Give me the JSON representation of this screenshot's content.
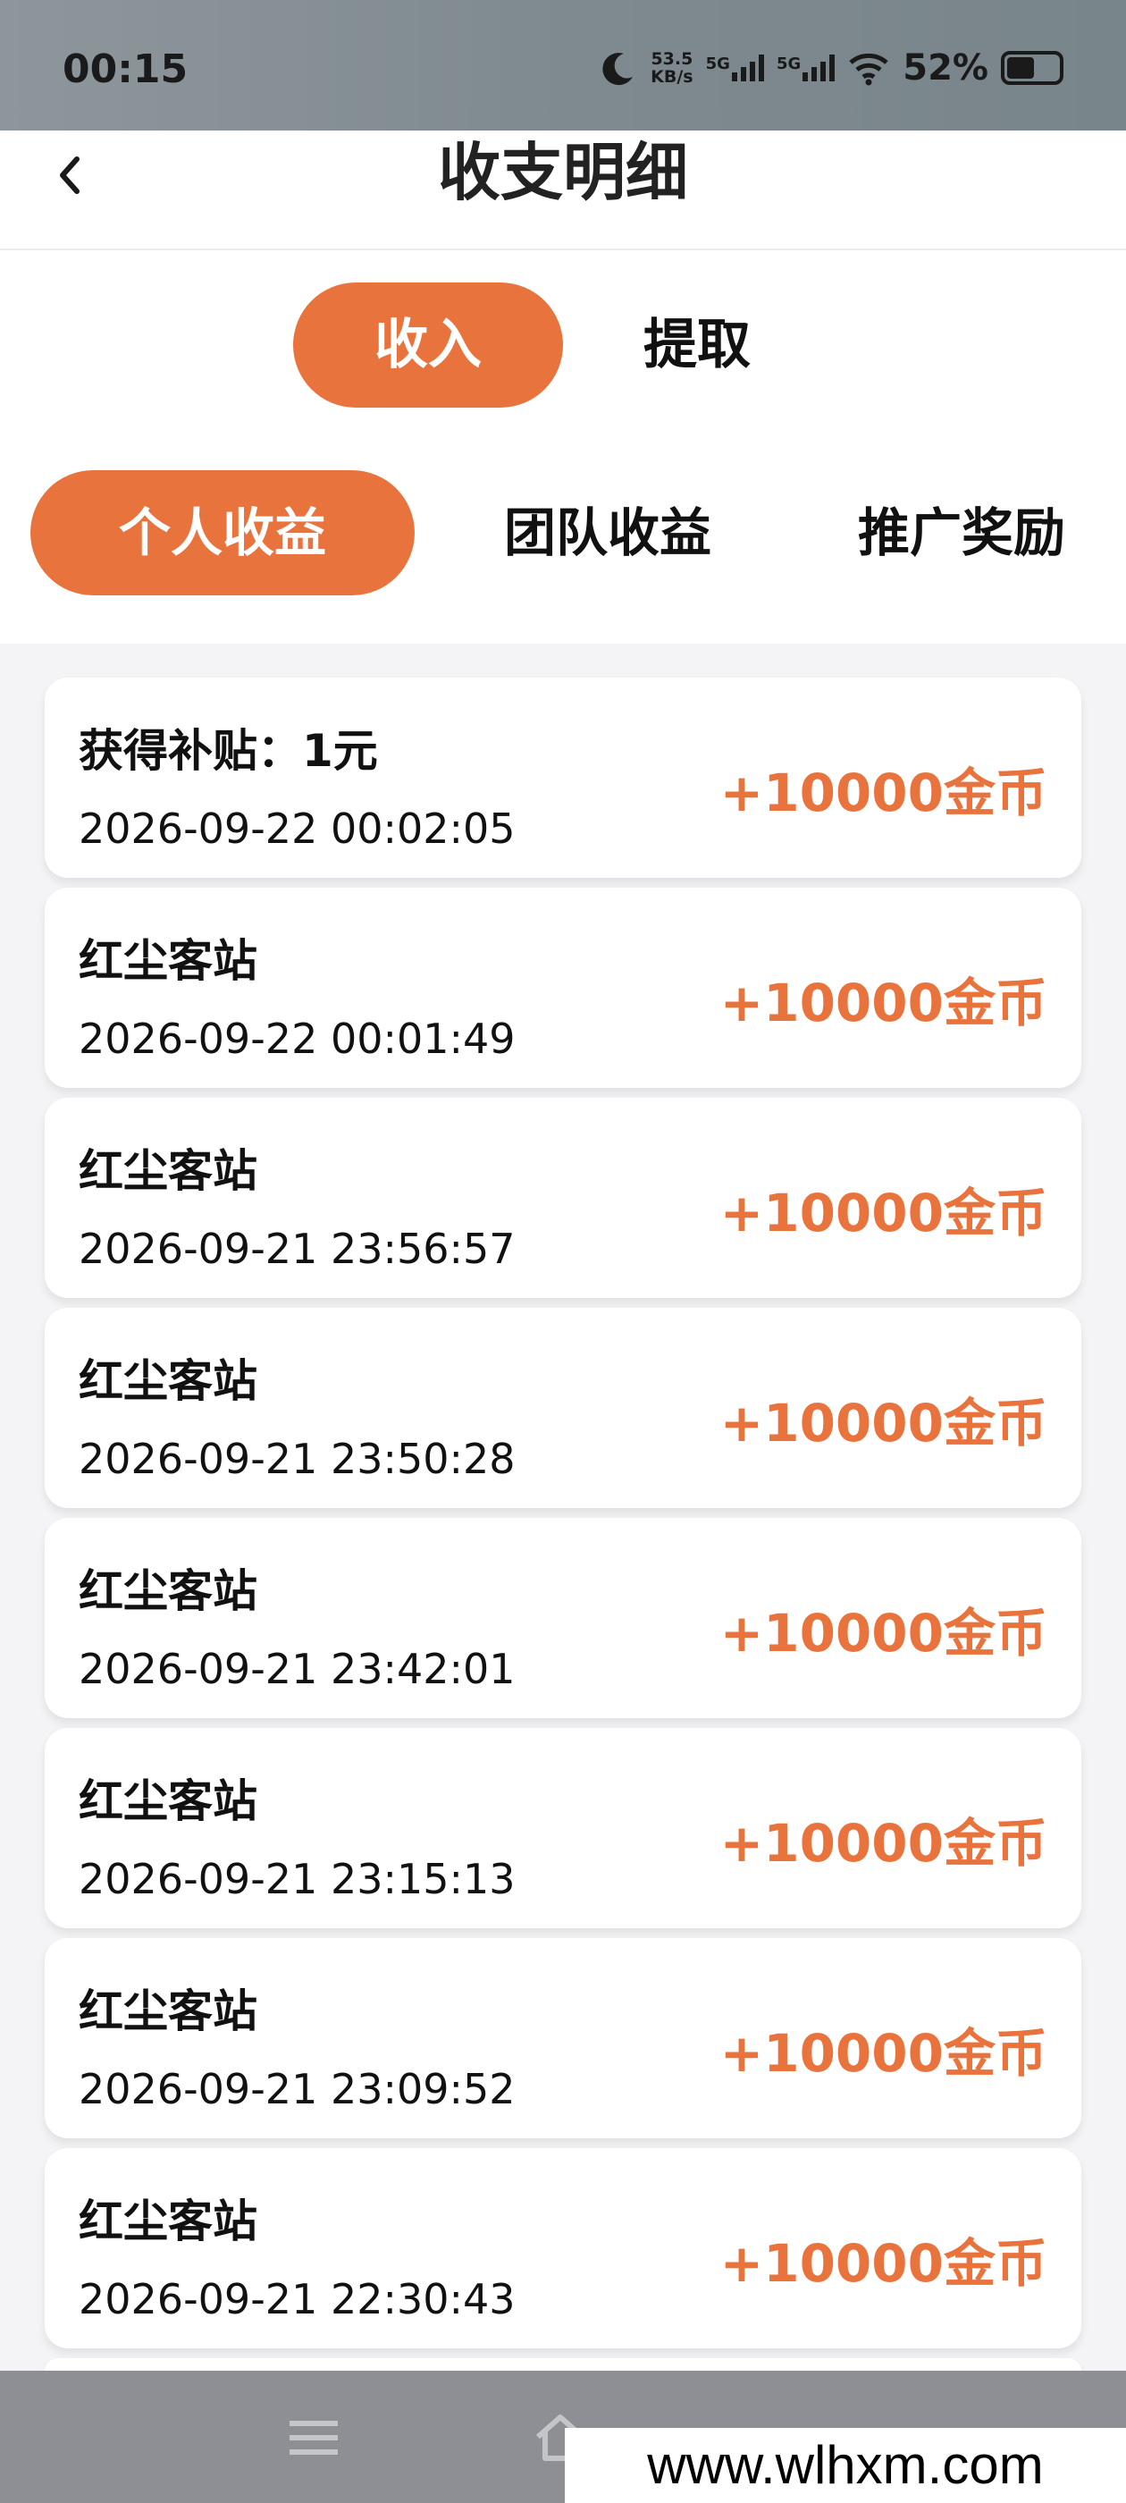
{
  "status_bar": {
    "time": "00:15",
    "speed_value": "53.5",
    "speed_unit": "KB/s",
    "sim1": "5G",
    "sim2": "5G",
    "battery": "52%",
    "battery_level": 0.52
  },
  "nav": {
    "title": "收支明细"
  },
  "main_tabs": [
    {
      "label": "收入",
      "active": true
    },
    {
      "label": "提取",
      "active": false
    }
  ],
  "sub_tabs": [
    {
      "label": "个人收益",
      "active": true
    },
    {
      "label": "团队收益",
      "active": false
    },
    {
      "label": "推广奖励",
      "active": false
    }
  ],
  "records": [
    {
      "title": "获得补贴：1元",
      "time": "2026-09-22 00:02:05",
      "amount": "+10000金币"
    },
    {
      "title": "红尘客站",
      "time": "2026-09-22 00:01:49",
      "amount": "+10000金币"
    },
    {
      "title": "红尘客站",
      "time": "2026-09-21 23:56:57",
      "amount": "+10000金币"
    },
    {
      "title": "红尘客站",
      "time": "2026-09-21 23:50:28",
      "amount": "+10000金币"
    },
    {
      "title": "红尘客站",
      "time": "2026-09-21 23:42:01",
      "amount": "+10000金币"
    },
    {
      "title": "红尘客站",
      "time": "2026-09-21 23:15:13",
      "amount": "+10000金币"
    },
    {
      "title": "红尘客站",
      "time": "2026-09-21 23:09:52",
      "amount": "+10000金币"
    },
    {
      "title": "红尘客站",
      "time": "2026-09-21 22:30:43",
      "amount": "+10000金币"
    }
  ],
  "watermark": "www.wlhxm.com",
  "colors": {
    "accent": "#e9733d",
    "background": "#f4f4f6"
  }
}
